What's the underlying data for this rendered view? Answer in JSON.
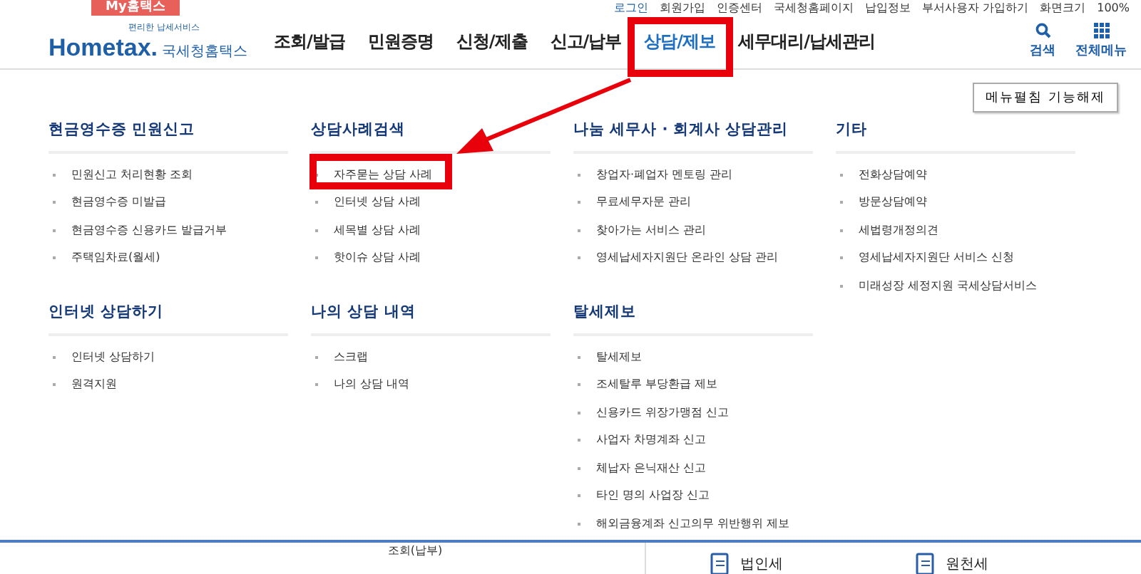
{
  "my_tab": "My홈택스",
  "top_links": [
    "로그인",
    "회원가입",
    "인증센터",
    "국세청홈페이지",
    "납입정보",
    "부서사용자 가입하기",
    "화면크기",
    "100%"
  ],
  "logo": {
    "tagline": "편리한 납세서비스",
    "brand": "Hometax.",
    "name": "국세청홈택스"
  },
  "nav": [
    {
      "label": "조회/발급",
      "selected": false
    },
    {
      "label": "민원증명",
      "selected": false
    },
    {
      "label": "신청/제출",
      "selected": false
    },
    {
      "label": "신고/납부",
      "selected": false
    },
    {
      "label": "상담/제보",
      "selected": true
    },
    {
      "label": "세무대리/납세관리",
      "selected": false
    }
  ],
  "header_tools": [
    {
      "kind": "search",
      "label": "검색"
    },
    {
      "kind": "menu",
      "label": "전체메뉴"
    }
  ],
  "collapse_button": "메뉴펼침 기능해제",
  "columns": [
    [
      {
        "title": "현금영수증 민원신고",
        "items": [
          "민원신고 처리현황 조회",
          "현금영수증 미발급",
          "현금영수증 신용카드 발급거부",
          "주택임차료(월세)"
        ]
      },
      {
        "title": "인터넷 상담하기",
        "items": [
          "인터넷 상담하기",
          "원격지원"
        ]
      }
    ],
    [
      {
        "title": "상담사례검색",
        "items": [
          "자주묻는 상담 사례",
          "인터넷 상담 사례",
          "세목별 상담 사례",
          "핫이슈 상담 사례"
        ]
      },
      {
        "title": "나의 상담 내역",
        "items": [
          "스크랩",
          "나의 상담 내역"
        ]
      }
    ],
    [
      {
        "title": "나눔 세무사 · 회계사 상담관리",
        "items": [
          "창업자·폐업자 멘토링 관리",
          "무료세무자문 관리",
          "찾아가는 서비스 관리",
          "영세납세자지원단 온라인 상담 관리"
        ]
      },
      {
        "title": "탈세제보",
        "items": [
          "탈세제보",
          "조세탈루 부당환급 제보",
          "신용카드 위장가맹점 신고",
          "사업자 차명계좌 신고",
          "체납자 은닉재산 신고",
          "타인 명의 사업장 신고",
          "해외금융계좌 신고의무 위반행위 제보"
        ]
      }
    ],
    [
      {
        "title": "기타",
        "items": [
          "전화상담예약",
          "방문상담예약",
          "세법령개정의견",
          "영세납세자지원단 서비스 신청",
          "미래성장 세정지원 국세상담서비스"
        ]
      }
    ]
  ],
  "footer": {
    "left": "조회(납부)",
    "shortcuts": [
      "법인세",
      "원천세"
    ]
  }
}
